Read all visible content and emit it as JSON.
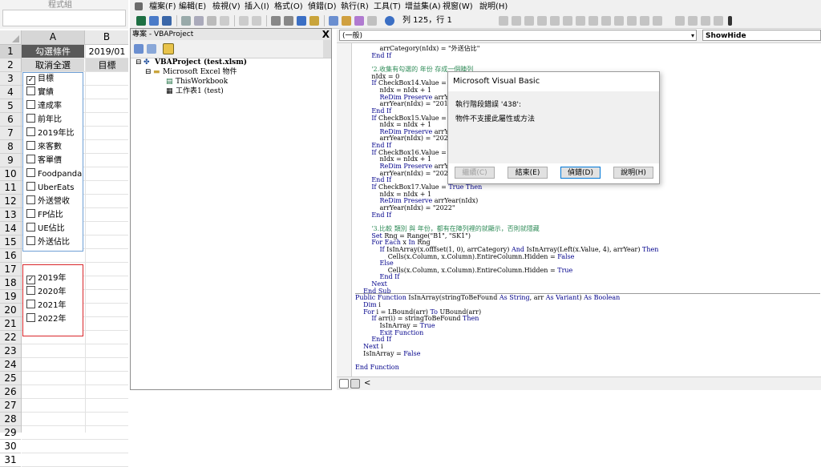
{
  "excel": {
    "partial_top_label": "程式組",
    "columns": [
      "A",
      "B"
    ],
    "rows": [
      "1",
      "2",
      "3",
      "4",
      "5",
      "6",
      "7",
      "8",
      "9",
      "10",
      "11",
      "12",
      "13",
      "14",
      "15",
      "16",
      "17",
      "18",
      "19",
      "20",
      "21",
      "22",
      "23",
      "24",
      "25",
      "26",
      "27",
      "28",
      "29",
      "30",
      "31"
    ],
    "row1": {
      "a": "勾選條件",
      "b": "2019/01"
    },
    "row2": {
      "a": "取消全選",
      "b": "目標"
    },
    "checkboxes1": [
      {
        "label": "目標",
        "checked": true
      },
      {
        "label": "實績",
        "checked": false
      },
      {
        "label": "達成率",
        "checked": false
      },
      {
        "label": "前年比",
        "checked": false
      },
      {
        "label": "2019年比",
        "checked": false
      },
      {
        "label": "來客數",
        "checked": false
      },
      {
        "label": "客單價",
        "checked": false
      },
      {
        "label": "Foodpanda",
        "checked": false
      },
      {
        "label": "UberEats",
        "checked": false
      },
      {
        "label": "外送營收",
        "checked": false
      },
      {
        "label": "FP佔比",
        "checked": false
      },
      {
        "label": "UE佔比",
        "checked": false
      },
      {
        "label": "外送佔比",
        "checked": false
      }
    ],
    "checkboxes2": [
      {
        "label": "2019年",
        "checked": true
      },
      {
        "label": "2020年",
        "checked": false
      },
      {
        "label": "2021年",
        "checked": false
      },
      {
        "label": "2022年",
        "checked": false
      }
    ]
  },
  "vbe": {
    "menu": [
      "檔案(F)",
      "編輯(E)",
      "檢視(V)",
      "插入(I)",
      "格式(O)",
      "偵錯(D)",
      "執行(R)",
      "工具(T)",
      "增益集(A)",
      "視窗(W)",
      "說明(H)"
    ],
    "row_col": "列 125，行 1",
    "project_title": "專案 - VBAProject",
    "project_close": "X",
    "tree": {
      "root": "VBAProject (test.xlsm)",
      "folder": "Microsoft Excel 物件",
      "workbook": "ThisWorkbook",
      "sheet": "工作表1 (test)"
    },
    "object_dropdown": "(一般)",
    "proc_dropdown": "ShowHide",
    "code": [
      "            arrCategory(nIdx) = \"外送佔比\"",
      "        End If",
      "",
      "        '2.收集有勾選的 年份 存成一個陣列",
      "        nIdx = 0",
      "        If CheckBox14.Value = True Then",
      "            nIdx = nIdx + 1",
      "            ReDim Preserve arrYear(nIdx)",
      "            arrYear(nIdx) = \"2019\"",
      "        End If",
      "        If CheckBox15.Value = True Then",
      "            nIdx = nIdx + 1",
      "            ReDim Preserve arrYear(nIdx)",
      "            arrYear(nIdx) = \"2020\"",
      "        End If",
      "        If CheckBox16.Value = True Then",
      "            nIdx = nIdx + 1",
      "            ReDim Preserve arrYear(nIdx)",
      "            arrYear(nIdx) = \"2021\"",
      "        End If",
      "        If CheckBox17.Value = True Then",
      "            nIdx = nIdx + 1",
      "            ReDim Preserve arrYear(nIdx)",
      "            arrYear(nIdx) = \"2022\"",
      "        End If",
      "",
      "        '3.比較 類別 與 年份，都有在陣列裡的就顯示，否則就隱藏",
      "        Set Rng = Range(\"B1\", \"SK1\")",
      "        For Each x In Rng",
      "            If IsInArray(x.offfset(1, 0), arrCategory) And IsInArray(Left(x.Value, 4), arrYear) Then",
      "                Cells(x.Column, x.Column).EntireColumn.Hidden = False",
      "            Else",
      "                Cells(x.Column, x.Column).EntireColumn.Hidden = True",
      "            End If",
      "        Next",
      "    End Sub",
      "Public Function IsInArray(stringToBeFound As String, arr As Variant) As Boolean",
      "    Dim i",
      "    For i = LBound(arr) To UBound(arr)",
      "        If arr(i) = stringToBeFound Then",
      "            IsInArray = True",
      "            Exit Function",
      "        End If",
      "    Next i",
      "    IsInArray = False",
      "",
      "End Function"
    ]
  },
  "dialog": {
    "title": "Microsoft Visual Basic",
    "error_line": "執行階段錯誤 '438':",
    "message": "物件不支援此屬性或方法",
    "buttons": [
      "繼續(C)",
      "結束(E)",
      "偵錯(D)",
      "說明(H)"
    ]
  },
  "colors": {
    "header_dark": "#595959",
    "checkbox_group_border": "#6fa0d6",
    "year_group_border": "#d9262a",
    "keyword": "#00008b",
    "comment": "#2e8b57"
  }
}
